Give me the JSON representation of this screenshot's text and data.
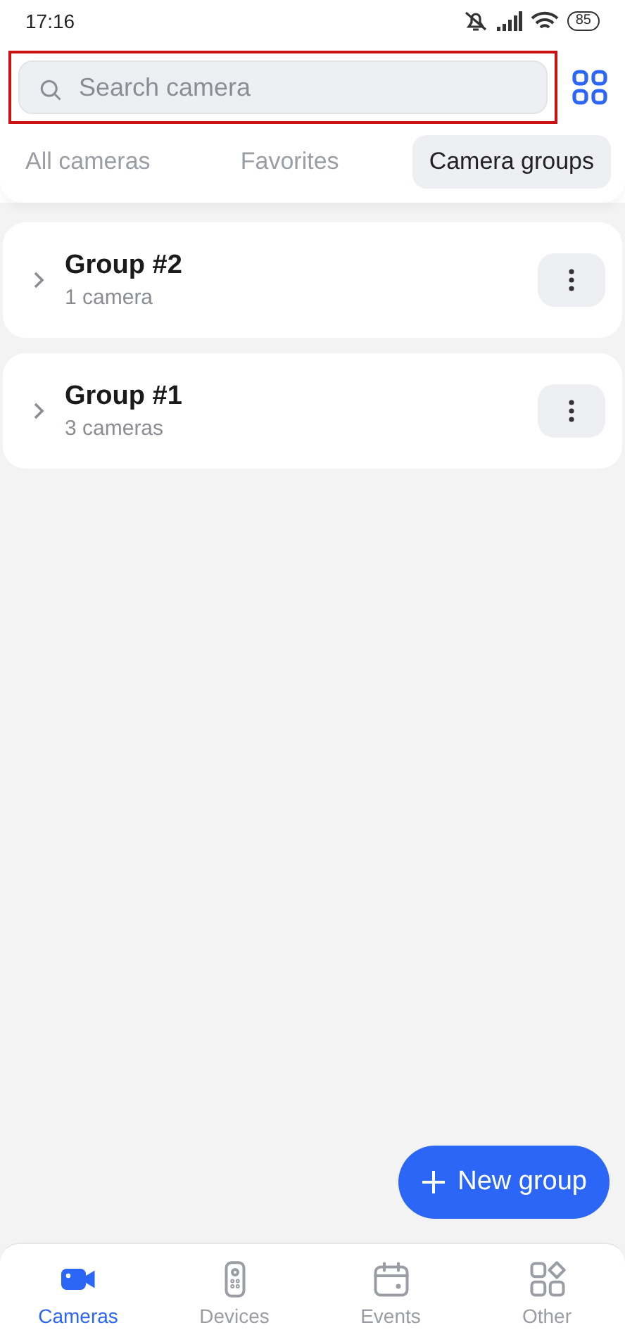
{
  "status_bar": {
    "time": "17:16",
    "battery": "85"
  },
  "search": {
    "placeholder": "Search camera",
    "highlighted": true
  },
  "tabs": [
    {
      "label": "All cameras",
      "selected": false
    },
    {
      "label": "Favorites",
      "selected": false
    },
    {
      "label": "Camera groups",
      "selected": true
    }
  ],
  "groups": [
    {
      "name": "Group #2",
      "count": "1 camera"
    },
    {
      "name": "Group #1",
      "count": "3 cameras"
    }
  ],
  "fab": {
    "label": "New group"
  },
  "bottom_nav": [
    {
      "label": "Cameras",
      "kind": "camera",
      "selected": true
    },
    {
      "label": "Devices",
      "kind": "remote",
      "selected": false
    },
    {
      "label": "Events",
      "kind": "calendar",
      "selected": false
    },
    {
      "label": "Other",
      "kind": "apps",
      "selected": false
    }
  ]
}
